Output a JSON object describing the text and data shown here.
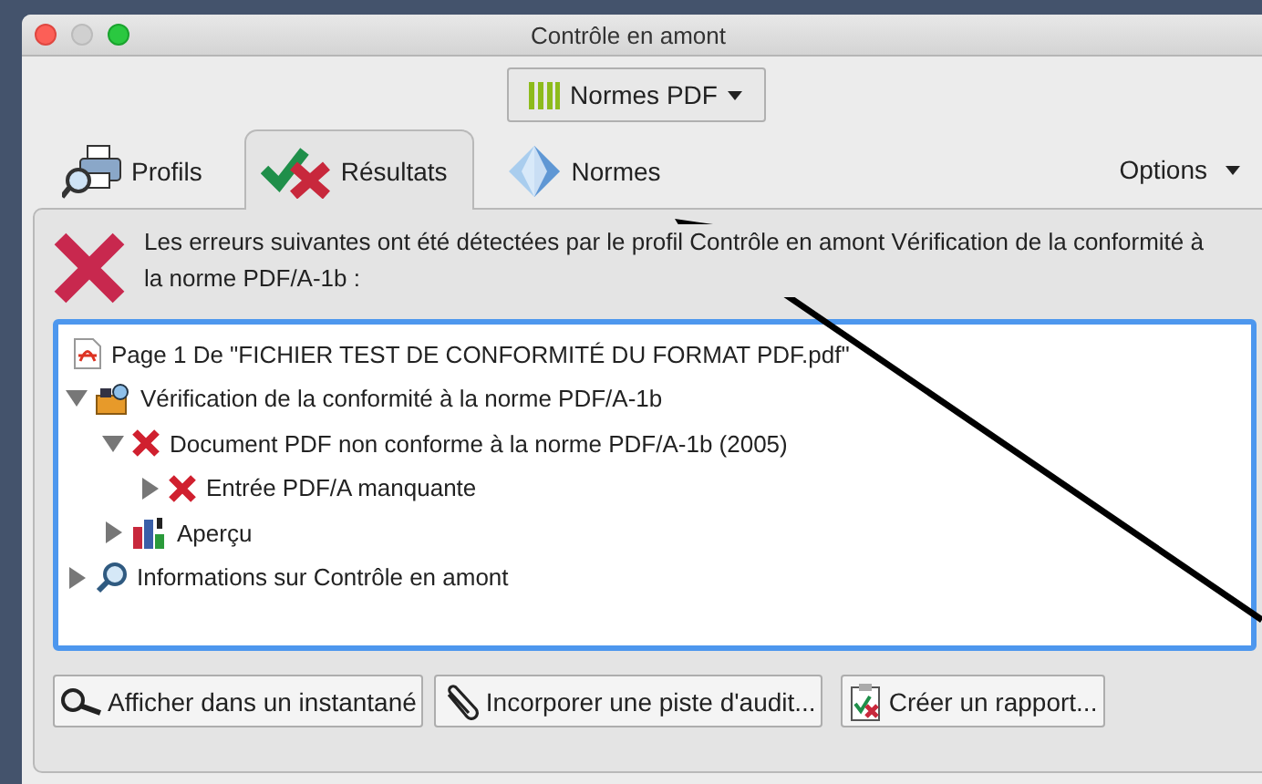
{
  "window": {
    "title": "Contrôle en amont"
  },
  "toolbar": {
    "dropdown": "Normes PDF"
  },
  "tabs": [
    {
      "label": "Profils",
      "selected": false
    },
    {
      "label": "Résultats",
      "selected": true
    },
    {
      "label": "Normes",
      "selected": false
    }
  ],
  "options_menu": "Options",
  "message": "Les erreurs suivantes ont été détectées par le profil Contrôle en amont Vérification de la conformité à la norme PDF/A-1b :",
  "tree": [
    {
      "kind": "pdf",
      "label": "Page 1 De \"FICHIER TEST DE CONFORMITÉ DU FORMAT PDF.pdf\""
    },
    {
      "kind": "check",
      "label": "Vérification de la conformité à la norme PDF/A-1b",
      "expanded": true,
      "children": [
        {
          "kind": "error",
          "label": "Document PDF non conforme à la norme PDF/A-1b (2005)",
          "expanded": true,
          "children": [
            {
              "kind": "error",
              "label": "Entrée PDF/A manquante",
              "expanded": false
            }
          ]
        },
        {
          "kind": "chart",
          "label": "Aperçu",
          "expanded": false
        }
      ]
    },
    {
      "kind": "info",
      "label": "Informations sur Contrôle en amont",
      "expanded": false
    }
  ],
  "buttons": [
    {
      "label": "Afficher dans un instantané"
    },
    {
      "label": "Incorporer une piste d'audit..."
    },
    {
      "label": "Créer un rapport..."
    }
  ]
}
